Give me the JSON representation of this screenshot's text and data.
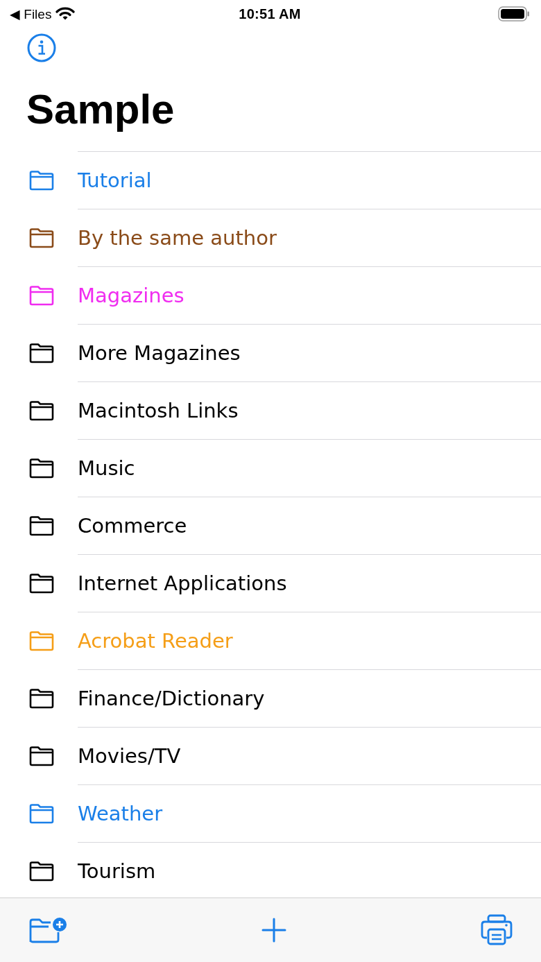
{
  "status_bar": {
    "back_label": "◀ Files",
    "time": "10:51 AM"
  },
  "title": "Sample",
  "folders": [
    {
      "name": "Tutorial",
      "color": "#1a7fe8"
    },
    {
      "name": "By the same author",
      "color": "#8a4b19"
    },
    {
      "name": "Magazines",
      "color": "#f02cf0"
    },
    {
      "name": "More Magazines",
      "color": "#000000"
    },
    {
      "name": "Macintosh Links",
      "color": "#000000"
    },
    {
      "name": "Music",
      "color": "#000000"
    },
    {
      "name": "Commerce",
      "color": "#000000"
    },
    {
      "name": "Internet Applications",
      "color": "#000000"
    },
    {
      "name": "Acrobat Reader",
      "color": "#f59e17"
    },
    {
      "name": "Finance/Dictionary",
      "color": "#000000"
    },
    {
      "name": "Movies/TV",
      "color": "#000000"
    },
    {
      "name": "Weather",
      "color": "#1a7fe8"
    },
    {
      "name": "Tourism",
      "color": "#000000"
    }
  ]
}
